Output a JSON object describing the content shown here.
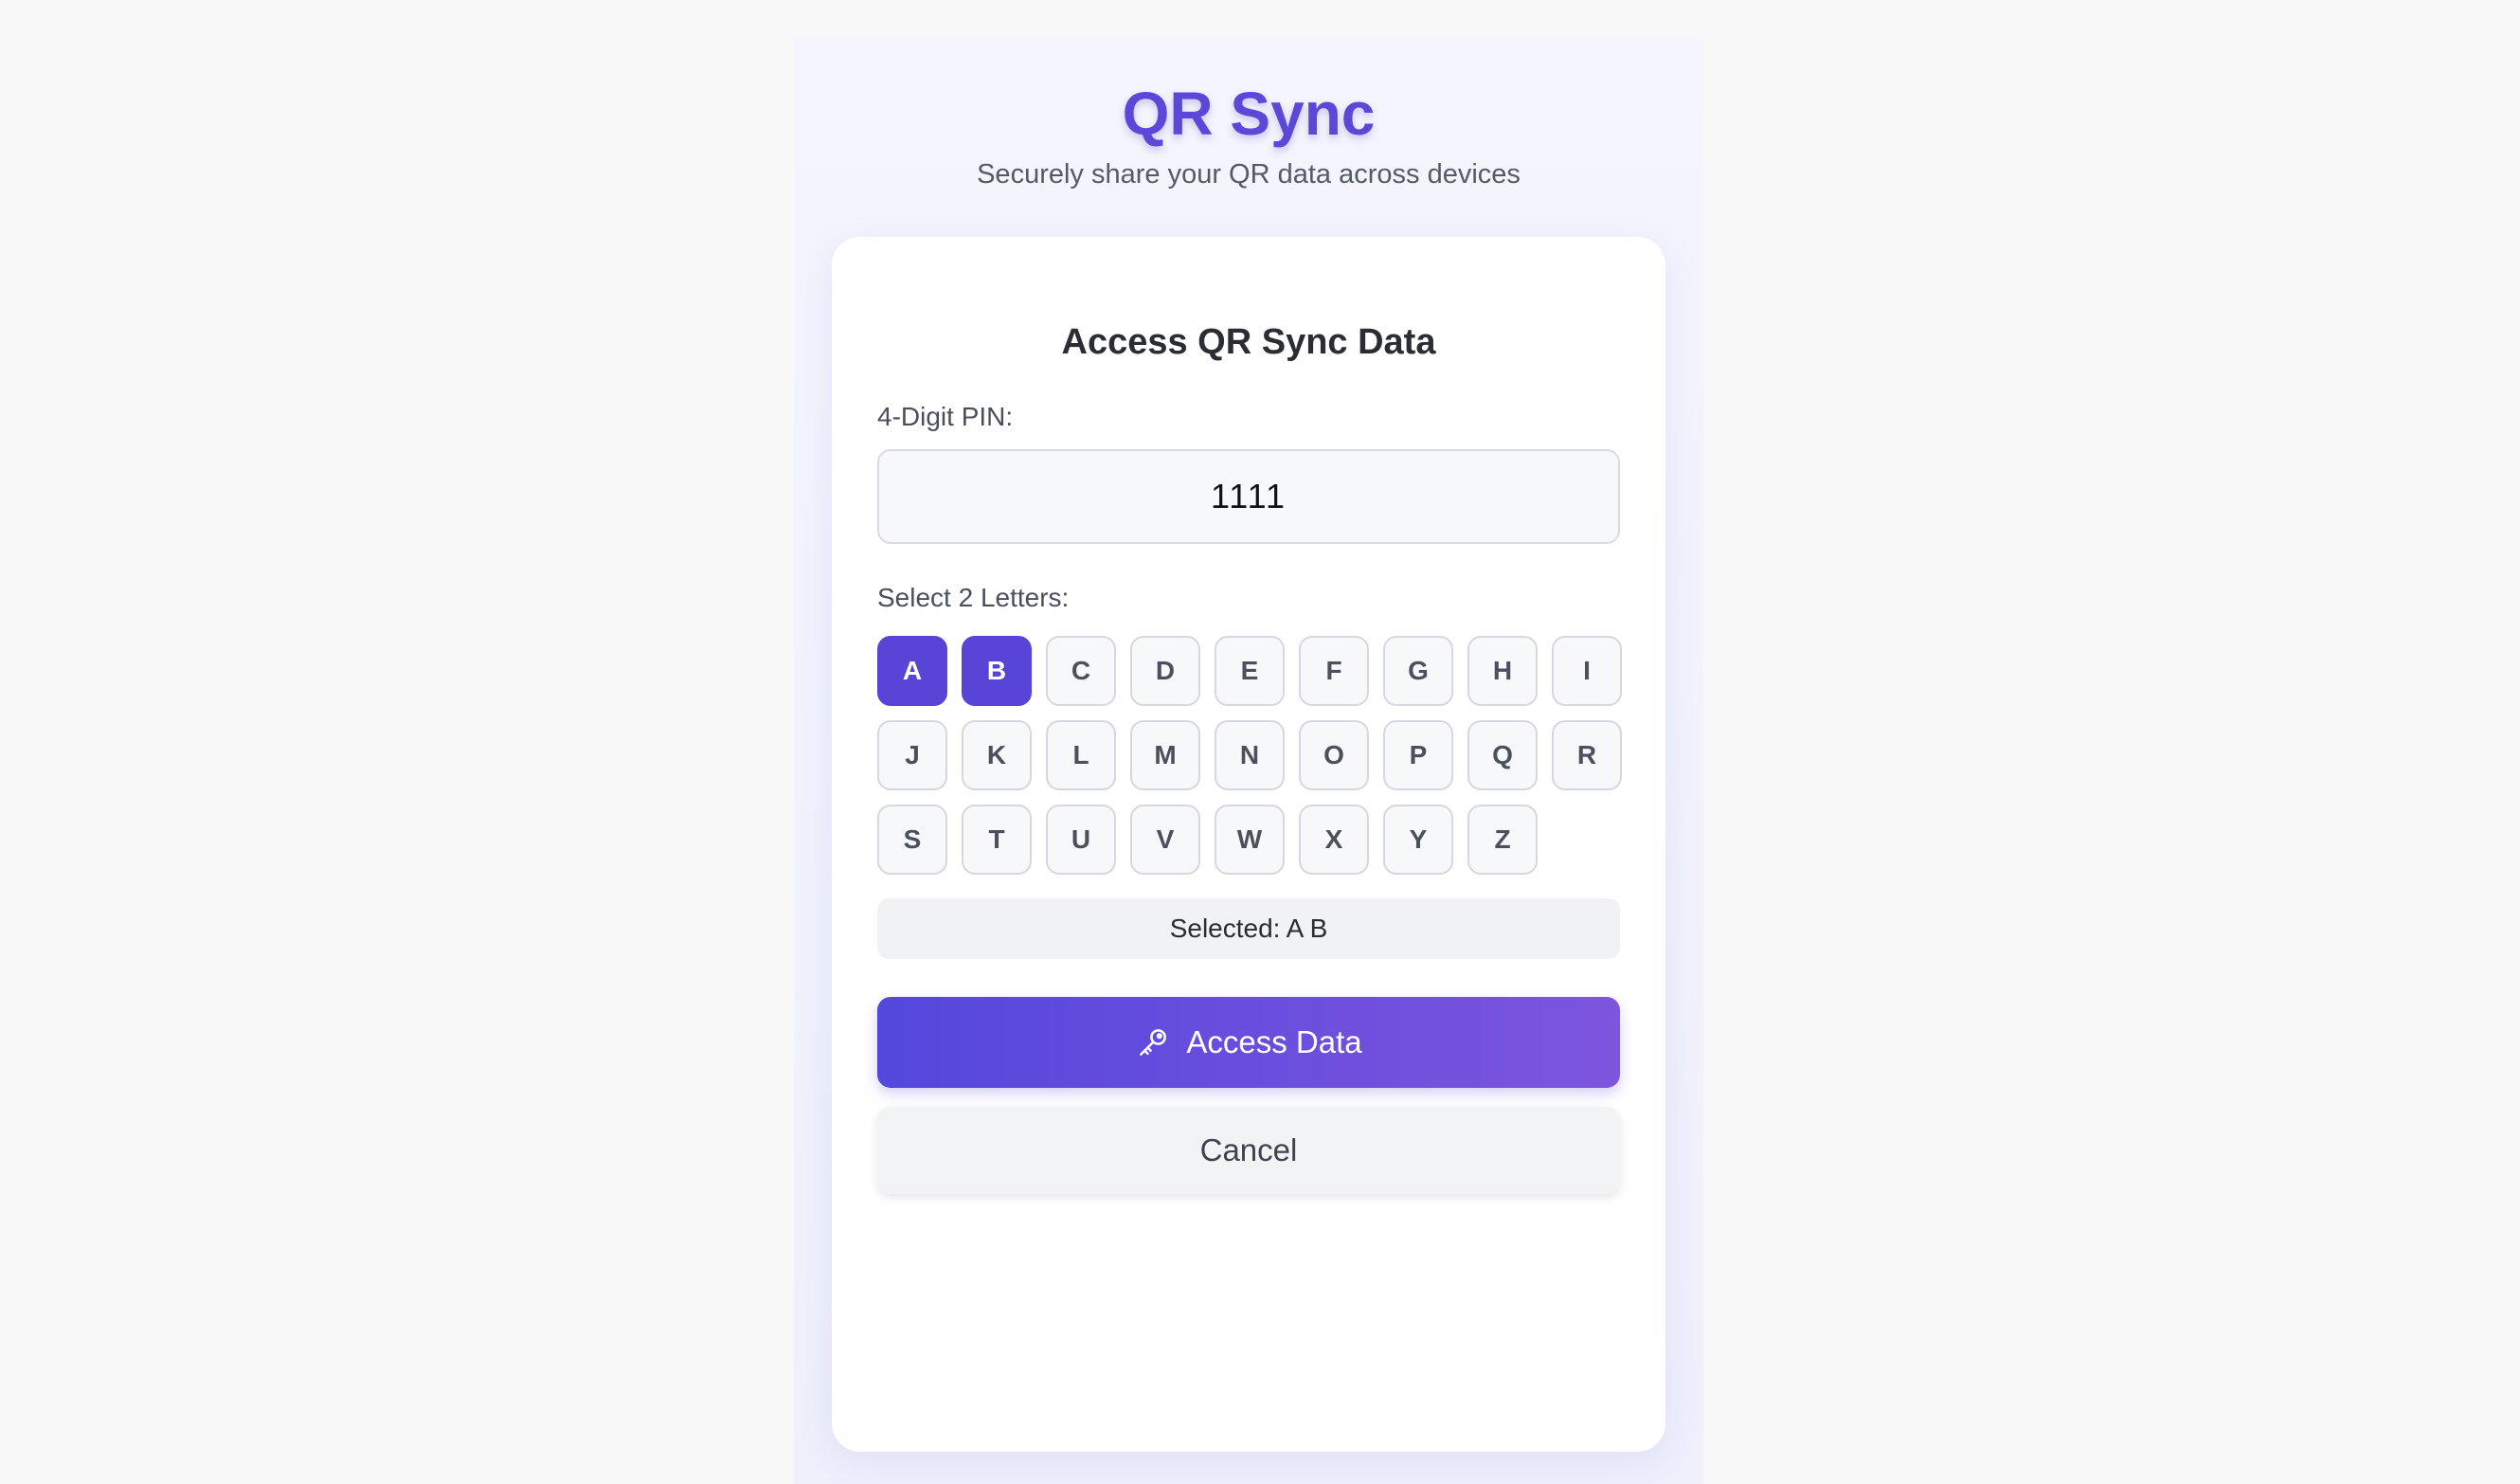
{
  "app": {
    "title": "QR Sync",
    "subtitle": "Securely share your QR data across devices"
  },
  "card": {
    "title": "Access QR Sync Data",
    "pin_label": "4-Digit PIN:",
    "pin_value": "1111",
    "letters_label": "Select 2 Letters:",
    "letters": [
      "A",
      "B",
      "C",
      "D",
      "E",
      "F",
      "G",
      "H",
      "I",
      "J",
      "K",
      "L",
      "M",
      "N",
      "O",
      "P",
      "Q",
      "R",
      "S",
      "T",
      "U",
      "V",
      "W",
      "X",
      "Y",
      "Z"
    ],
    "selected_letters": [
      "A",
      "B"
    ],
    "selected_text": "Selected: A B",
    "access_label": "Access Data",
    "access_icon": "key-icon",
    "cancel_label": "Cancel"
  },
  "colors": {
    "accent": "#5845d8",
    "accent_gradient_end": "#7d55de",
    "page_background": "#f8f8f8"
  }
}
